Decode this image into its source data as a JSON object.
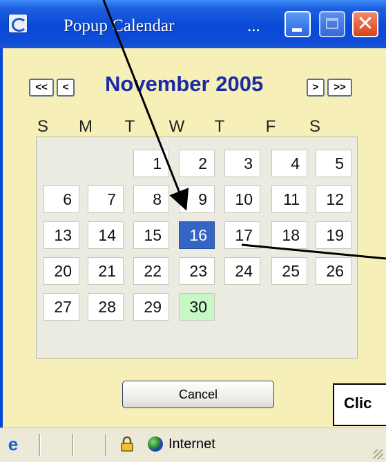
{
  "window": {
    "title": "Popup Calendar",
    "title_ellipsis": "...",
    "title_icon": "ie-page-icon",
    "controls": [
      "minimize-button",
      "maximize-button",
      "close-button"
    ]
  },
  "calendar": {
    "nav": {
      "prev_year": "<<",
      "prev_month": "<",
      "next_month": ">",
      "next_year": ">>"
    },
    "month_year": "November 2005",
    "weekdays": [
      "S",
      "M",
      "T",
      "W",
      "T",
      "F",
      "S"
    ],
    "weeks": [
      [
        "",
        "",
        "1",
        "2",
        "3",
        "4",
        "5"
      ],
      [
        "6",
        "7",
        "8",
        "9",
        "10",
        "11",
        "12"
      ],
      [
        "13",
        "14",
        "15",
        "16",
        "17",
        "18",
        "19"
      ],
      [
        "20",
        "21",
        "22",
        "23",
        "24",
        "25",
        "26"
      ],
      [
        "27",
        "28",
        "29",
        "30",
        "",
        "",
        ""
      ]
    ],
    "selected_day": "16",
    "highlighted_day": "30",
    "colors": {
      "background": "#f7efb8",
      "month_title": "#1a2aa8",
      "selected": "#3565c4",
      "highlighted": "#c6f7c4"
    }
  },
  "cancel_button": {
    "label": "Cancel"
  },
  "callout": {
    "text": "Clic"
  },
  "statusbar": {
    "zone": "Internet",
    "icons": [
      "ie-icon",
      "lock-icon",
      "globe-icon"
    ]
  }
}
